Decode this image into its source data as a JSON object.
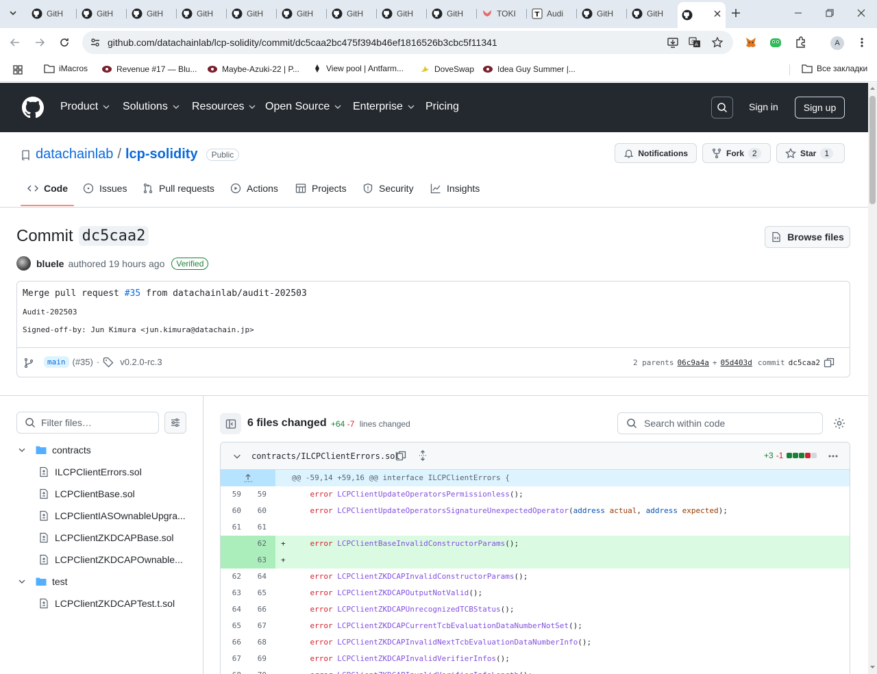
{
  "browser": {
    "tabs": [
      {
        "label": "GitH"
      },
      {
        "label": "GitH"
      },
      {
        "label": "GitH"
      },
      {
        "label": "GitH"
      },
      {
        "label": "GitH"
      },
      {
        "label": "GitH"
      },
      {
        "label": "GitH"
      },
      {
        "label": "GitH"
      },
      {
        "label": "GitH"
      },
      {
        "label": "TOKI"
      },
      {
        "label": "Audi"
      },
      {
        "label": "GitH"
      },
      {
        "label": "GitH"
      },
      {
        "label": ""
      }
    ],
    "url": "github.com/datachainlab/lcp-solidity/commit/dc5caa2bc475f394b46ef1816526b3cbc5f11341",
    "profile_initial": "A",
    "bookmarks": [
      {
        "label": "iMacros"
      },
      {
        "label": "Revenue #17 — Blu..."
      },
      {
        "label": "Maybe-Azuki-22 | P..."
      },
      {
        "label": "View pool | Antfarm..."
      },
      {
        "label": "DoveSwap"
      },
      {
        "label": "Idea Guy Summer |..."
      }
    ],
    "all_bookmarks": "Все закладки"
  },
  "gh_header": {
    "nav": [
      "Product",
      "Solutions",
      "Resources",
      "Open Source",
      "Enterprise",
      "Pricing"
    ],
    "sign_in": "Sign in",
    "sign_up": "Sign up"
  },
  "repo": {
    "owner": "datachainlab",
    "slash": "/",
    "name": "lcp-solidity",
    "visibility": "Public",
    "notifications": "Notifications",
    "fork_label": "Fork",
    "fork_count": "2",
    "star_label": "Star",
    "star_count": "1",
    "tabs": [
      "Code",
      "Issues",
      "Pull requests",
      "Actions",
      "Projects",
      "Security",
      "Insights"
    ]
  },
  "commit": {
    "title_prefix": "Commit",
    "sha_short": "dc5caa2",
    "browse_files": "Browse files",
    "author": "bluele",
    "authored": "authored 19 hours ago",
    "verified": "Verified",
    "message_title_pre": "Merge pull request ",
    "message_pr": "#35",
    "message_title_post": " from datachainlab/audit-202503",
    "message_body": "Audit-202503\n\nSigned-off-by: Jun Kimura <jun.kimura@datachain.jp>",
    "branch": "main",
    "pr_ref": "(#35)",
    "dot": "·",
    "tag": "v0.2.0-rc.3",
    "parents_label": "2 parents",
    "parent1": "06c9a4a",
    "plus": "+",
    "parent2": "05d403d",
    "commit_label": "commit",
    "commit_sha": "dc5caa2"
  },
  "file_tree": {
    "filter_placeholder": "Filter files…",
    "folders": [
      {
        "name": "contracts",
        "files": [
          "ILCPClientErrors.sol",
          "LCPClientBase.sol",
          "LCPClientIASOwnableUpgra...",
          "LCPClientZKDCAPBase.sol",
          "LCPClientZKDCAPOwnable..."
        ]
      },
      {
        "name": "test",
        "files": [
          "LCPClientZKDCAPTest.t.sol"
        ]
      }
    ]
  },
  "diff": {
    "files_changed": "6 files changed",
    "additions": "+64",
    "deletions": "-7",
    "lines_changed": "lines changed",
    "search_placeholder": "Search within code",
    "file": {
      "path": "contracts/ILCPClientErrors.sol",
      "additions": "+3",
      "deletions": "-1",
      "hunk": "@@ -59,14 +59,16 @@ interface ILCPClientErrors {",
      "lines": [
        {
          "old": "59",
          "new": "59",
          "type": "ctx",
          "name": "LCPClientUpdateOperatorsPermissionless",
          "args": "();"
        },
        {
          "old": "60",
          "new": "60",
          "type": "ctx",
          "name": "LCPClientUpdateOperatorsSignatureUnexpectedOperator",
          "args": "(address actual, address expected);"
        },
        {
          "old": "61",
          "new": "61",
          "type": "blank"
        },
        {
          "old": "",
          "new": "62",
          "type": "add",
          "name": "LCPClientBaseInvalidConstructorParams",
          "args": "();"
        },
        {
          "old": "",
          "new": "63",
          "type": "addblank"
        },
        {
          "old": "62",
          "new": "64",
          "type": "ctx",
          "name": "LCPClientZKDCAPInvalidConstructorParams",
          "args": "();"
        },
        {
          "old": "63",
          "new": "65",
          "type": "ctx",
          "name": "LCPClientZKDCAPOutputNotValid",
          "args": "();"
        },
        {
          "old": "64",
          "new": "66",
          "type": "ctx",
          "name": "LCPClientZKDCAPUnrecognizedTCBStatus",
          "args": "();"
        },
        {
          "old": "65",
          "new": "67",
          "type": "ctx",
          "name": "LCPClientZKDCAPCurrentTcbEvaluationDataNumberNotSet",
          "args": "();"
        },
        {
          "old": "66",
          "new": "68",
          "type": "ctx",
          "name": "LCPClientZKDCAPInvalidNextTcbEvaluationDataNumberInfo",
          "args": "();"
        },
        {
          "old": "67",
          "new": "69",
          "type": "ctx",
          "name": "LCPClientZKDCAPInvalidVerifierInfos",
          "args": "();"
        },
        {
          "old": "68",
          "new": "70",
          "type": "ctx",
          "name": "LCPClientZKDCAPInvalidVerifierInfoLength",
          "args": "();"
        }
      ],
      "keyword": "error"
    }
  }
}
